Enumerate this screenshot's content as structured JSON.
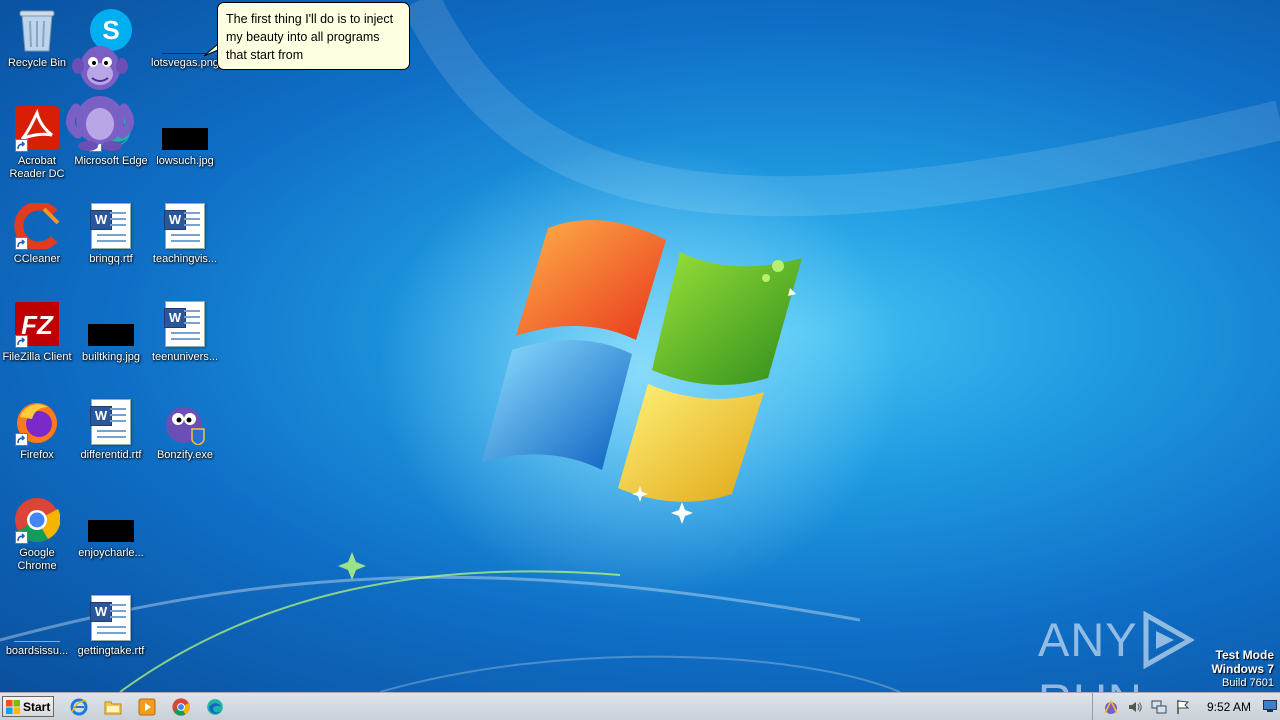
{
  "desktop": {
    "icons": [
      {
        "label": "Recycle Bin"
      },
      {
        "label": "Skype"
      },
      {
        "label": "lotsvegas.png"
      },
      {
        "label": "Acrobat Reader DC"
      },
      {
        "label": "Microsoft Edge"
      },
      {
        "label": "lowsuch.jpg"
      },
      {
        "label": "CCleaner"
      },
      {
        "label": "bringq.rtf"
      },
      {
        "label": "teachingvis..."
      },
      {
        "label": "FileZilla Client"
      },
      {
        "label": "builtking.jpg"
      },
      {
        "label": "teenunivers..."
      },
      {
        "label": "Firefox"
      },
      {
        "label": "differentid.rtf"
      },
      {
        "label": "Bonzify.exe"
      },
      {
        "label": "Google Chrome"
      },
      {
        "label": "enjoycharle..."
      },
      {
        "label": "boardsissu..."
      },
      {
        "label": "gettingtake.rtf"
      }
    ]
  },
  "balloon": {
    "text": "The first thing I'll do is to inject my beauty into all programs that start from"
  },
  "watermark": {
    "left": "ANY",
    "right": "RUN"
  },
  "test_mode": {
    "line1": "Test Mode",
    "line2": "Windows 7",
    "line3": "Build 7601"
  },
  "taskbar": {
    "start_label": "Start",
    "pinned": [
      {
        "icon": "internet-explorer-icon"
      },
      {
        "icon": "file-explorer-icon"
      },
      {
        "icon": "media-player-icon"
      },
      {
        "icon": "chrome-icon"
      },
      {
        "icon": "edge-icon"
      }
    ],
    "clock": "9:52 AM"
  },
  "colors": {
    "accent": "#1f9be2",
    "balloon_bg": "#ffffe1",
    "taskbar": "#d4dae1",
    "bonzi": "#7a5fc4"
  }
}
